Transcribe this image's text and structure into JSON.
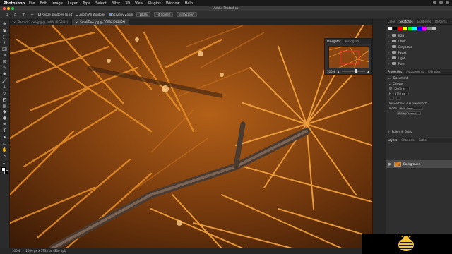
{
  "menubar": {
    "app_name": "Photoshop",
    "items": [
      "File",
      "Edit",
      "Image",
      "Layer",
      "Type",
      "Select",
      "Filter",
      "3D",
      "View",
      "Plugins",
      "Window",
      "Help"
    ]
  },
  "window": {
    "title": "Adobe Photoshop"
  },
  "options_bar": {
    "resize_windows_label": "Resize Windows to Fit",
    "zoom_all_label": "Zoom All Windows",
    "scrubby_zoom_label": "Scrubby Zoom",
    "zoom_percent": "100%",
    "fit_screen_label": "Fit Screen",
    "fill_screen_label": "Fill Screen"
  },
  "doc_tabs": [
    {
      "label": "Barrack7.cee.jpg @ 100% (RGB/8*)",
      "active": false
    },
    {
      "label": "SmallTree.jpg @ 100% (RGB/8*)",
      "active": true
    }
  ],
  "tools": [
    "move-icon",
    "artboard-icon",
    "marquee-icon",
    "lasso-icon",
    "object-select-icon",
    "crop-icon",
    "frame-icon",
    "eyedropper-icon",
    "healing-icon",
    "brush-icon",
    "stamp-icon",
    "history-brush-icon",
    "eraser-icon",
    "gradient-icon",
    "blur-icon",
    "dodge-icon",
    "pen-icon",
    "type-icon",
    "path-select-icon",
    "shape-icon",
    "hand-icon",
    "zoom-icon",
    "more-tools-icon"
  ],
  "navigator": {
    "tabs": [
      "Navigator",
      "Histogram"
    ],
    "zoom": "100%"
  },
  "panels": {
    "top_tabs": [
      "Color",
      "Swatches",
      "Gradients",
      "Patterns"
    ],
    "swatch_colors": [
      "#ffffff",
      "#000000",
      "#ff0000",
      "#ffff00",
      "#00ff00",
      "#00ffff",
      "#0000ff",
      "#ff00ff",
      "#808080",
      "#c0c0c0"
    ],
    "swatch_folders": [
      "RGB",
      "CMYK",
      "Grayscale",
      "Pastel",
      "Light",
      "Pure"
    ],
    "properties_tabs": [
      "Properties",
      "Adjustments",
      "Libraries"
    ],
    "properties": {
      "document_label": "Document",
      "canvas_label": "Canvas",
      "width_label": "W",
      "width_value": "2600 px",
      "height_label": "H",
      "height_value": "1733 px",
      "resolution_label": "Resolution: 300 pixels/inch",
      "mode_label": "Mode",
      "mode_value": "RGB Color",
      "depth_value": "8 Bits/Channel",
      "rulers_label": "Rulers & Grids"
    },
    "layers_tabs": [
      "Layers",
      "Channels",
      "Paths"
    ],
    "layer_name": "Background"
  },
  "status_bar": {
    "zoom": "100%",
    "dimensions": "2600 px x 1733 px (300 ppi)"
  }
}
